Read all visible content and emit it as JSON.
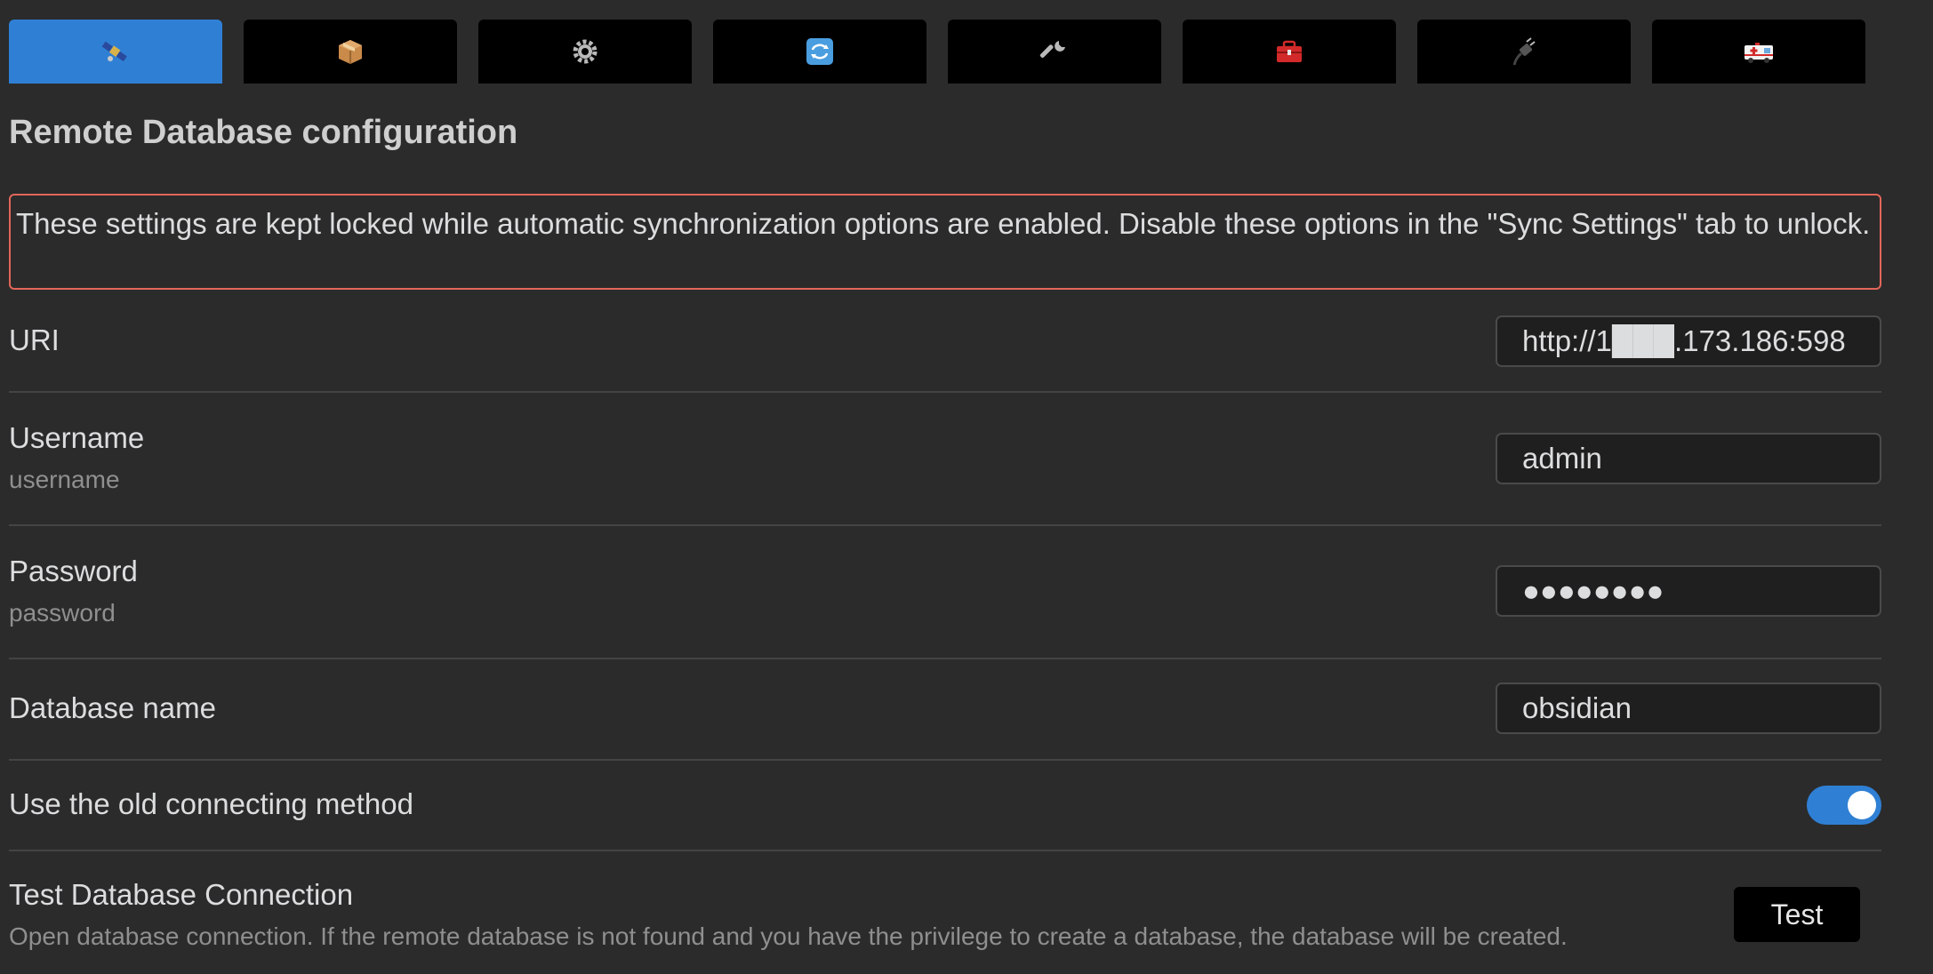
{
  "tabs": [
    {
      "icon": "satellite-icon",
      "active": true
    },
    {
      "icon": "package-icon",
      "active": false
    },
    {
      "icon": "gear-icon",
      "active": false
    },
    {
      "icon": "sync-icon",
      "active": false
    },
    {
      "icon": "wrench-icon",
      "active": false
    },
    {
      "icon": "toolbox-icon",
      "active": false
    },
    {
      "icon": "plug-icon",
      "active": false
    },
    {
      "icon": "ambulance-icon",
      "active": false
    }
  ],
  "title": "Remote Database configuration",
  "warning": "These settings are kept locked while automatic synchronization options are enabled. Disable these options in the \"Sync Settings\" tab to unlock.",
  "uri": {
    "label": "URI",
    "value": "http://1███.173.186:598"
  },
  "username": {
    "label": "Username",
    "desc": "username",
    "value": "admin"
  },
  "password": {
    "label": "Password",
    "desc": "password",
    "value": "●●●●●●●●"
  },
  "database": {
    "label": "Database name",
    "value": "obsidian"
  },
  "old_method": {
    "label": "Use the old connecting method",
    "enabled": true
  },
  "test": {
    "label": "Test Database Connection",
    "desc": "Open database connection. If the remote database is not found and you have the privilege to create a database, the database will be created.",
    "button": "Test"
  },
  "colors": {
    "accent": "#2f80d5",
    "warning_border": "#e3665a",
    "background": "#2b2b2b"
  }
}
